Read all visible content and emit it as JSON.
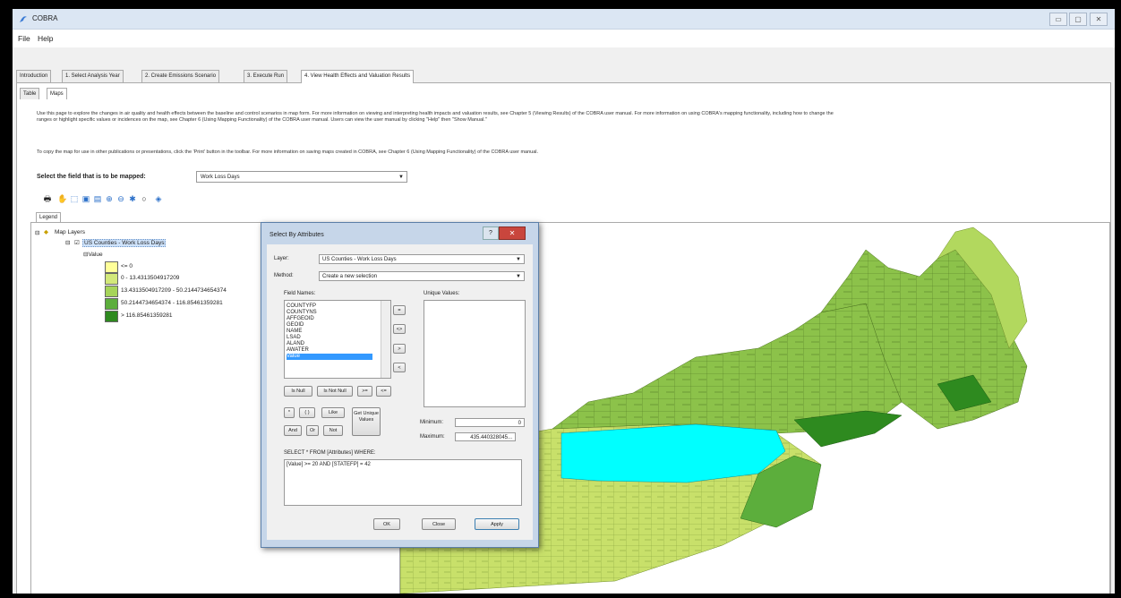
{
  "window": {
    "title": "COBRA",
    "controls": [
      "▭",
      "▢",
      "✕"
    ]
  },
  "menu": {
    "file": "File",
    "help": "Help"
  },
  "tabs": [
    {
      "label": "Introduction"
    },
    {
      "label": "1. Select Analysis Year"
    },
    {
      "label": "2. Create Emissions Scenario"
    },
    {
      "label": "3. Execute Run"
    },
    {
      "label": "4. View Health Effects and Valuation Results"
    }
  ],
  "subtabs": {
    "table": "Table",
    "maps": "Maps"
  },
  "intro": {
    "text": "Use this page to explore the changes in air quality and health effects between the baseline and control scenarios in map form.  For more information on viewing and interpreting health impacts and valuation results, see Chapter 5 (Viewing Results) of the COBRA user manual.  For more information on using COBRA's mapping functionality, including how to change the ranges or highlight specific values or incidences on the map, see Chapter 6 (Using Mapping Functionality) of the COBRA user manual.  Users can view the user manual by clicking \"Help\" then \"Show Manual.\"",
    "print_note": "To copy the map for use in other publications or presentations, click the 'Print' button in the toolbar.  For more information on saving maps created in COBRA, see Chapter 6 (Using Mapping Functionality) of the COBRA user manual."
  },
  "field_select": {
    "label": "Select the field that is to be mapped:",
    "value": "Work Loss Days"
  },
  "legend": {
    "tab": "Legend",
    "root": "Map Layers",
    "layer": "US Counties - Work Loss Days",
    "value_node": "Value",
    "classes": [
      {
        "label": "<= 0",
        "color": "#ffff99"
      },
      {
        "label": "0 - 13.4313504917209",
        "color": "#d2e87a"
      },
      {
        "label": "13.4313504917209 - 50.2144734654374",
        "color": "#a6d45a"
      },
      {
        "label": "50.2144734654374 - 116.85461359281",
        "color": "#5cae3c"
      },
      {
        "label": "> 116.85461359281",
        "color": "#2e8a1f"
      }
    ]
  },
  "dialog": {
    "title": "Select By Attributes",
    "layer_label": "Layer:",
    "layer_value": "US Counties - Work Loss Days",
    "method_label": "Method:",
    "method_value": "Create a new selection",
    "field_names_label": "Field Names:",
    "unique_values_label": "Unique Values:",
    "fields": [
      "COUNTYFP",
      "COUNTYNS",
      "AFFGEOID",
      "GEOID",
      "NAME",
      "LSAD",
      "ALAND",
      "AWATER",
      "Value"
    ],
    "operators": {
      "eq": "=",
      "ne": "<>",
      "gt": ">",
      "lt": "<",
      "is_null": "Is Null",
      "is_not_null": "Is Not Null",
      "ge": ">=",
      "le": "<=",
      "star": "*",
      "paren": "( )",
      "like": "Like",
      "get_unique": "Get Unique Values",
      "and": "And",
      "or": "Or",
      "not": "Not"
    },
    "minimum_label": "Minimum:",
    "minimum_value": "0",
    "maximum_label": "Maximum:",
    "maximum_value": "435.440328045...",
    "where_label": "SELECT * FROM [Attributes] WHERE:",
    "expression": "[Value] >= 20 AND [STATEFP] = 42",
    "ok": "OK",
    "close": "Close",
    "apply": "Apply"
  }
}
